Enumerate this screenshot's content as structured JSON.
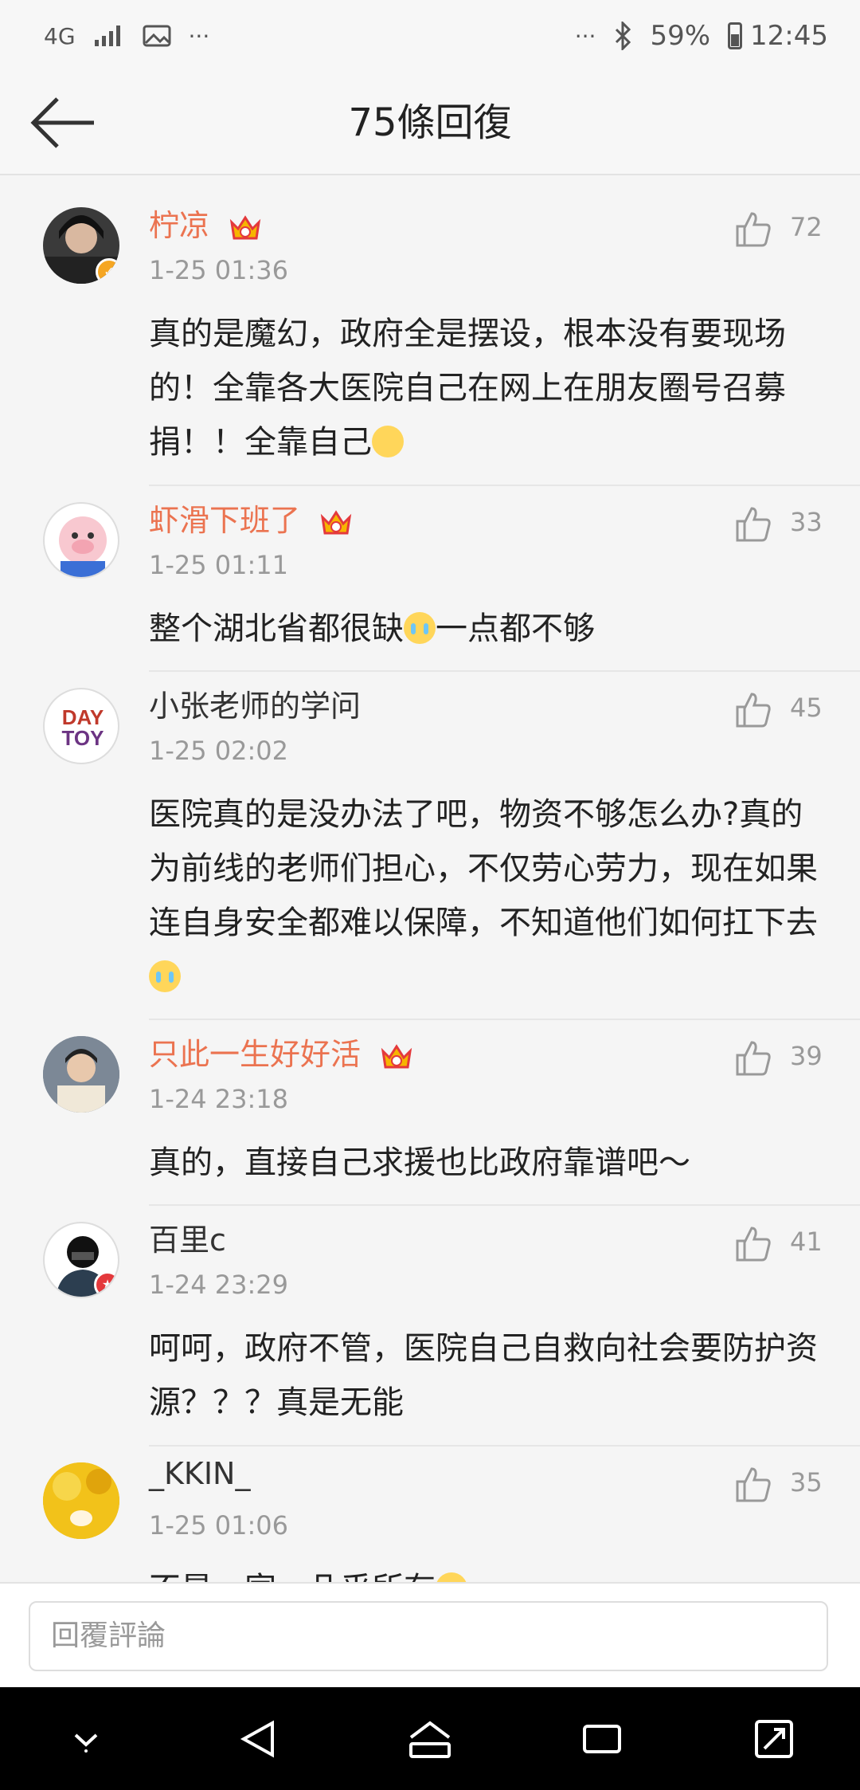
{
  "status": {
    "network": "4G",
    "battery": "59%",
    "time": "12:45",
    "more": "···"
  },
  "header": {
    "title": "75條回復"
  },
  "comments": [
    {
      "name": "柠凉",
      "time": "1-25 01:36",
      "likes": "72",
      "text": "真的是魔幻，政府全是摆设，根本没有要现场的！全靠各大医院自己在网上在朋友圈号召募捐！！全靠自己"
    },
    {
      "name": "虾滑下班了",
      "time": "1-25 01:11",
      "likes": "33",
      "text": "整个湖北省都很缺",
      "text2": "一点都不够"
    },
    {
      "name": "小张老师的学问",
      "time": "1-25 02:02",
      "likes": "45",
      "text": "医院真的是没办法了吧，物资不够怎么办?真的为前线的老师们担心，不仅劳心劳力，现在如果连自身安全都难以保障，不知道他们如何扛下去"
    },
    {
      "name": "只此一生好好活",
      "time": "1-24 23:18",
      "likes": "39",
      "text": "真的，直接自己求援也比政府靠谱吧～"
    },
    {
      "name": "百里c",
      "time": "1-24 23:29",
      "likes": "41",
      "text": "呵呵，政府不管，医院自己自救向社会要防护资源？？？真是无能"
    },
    {
      "name": "_KKIN_",
      "time": "1-25 01:06",
      "likes": "35",
      "text": "不是一家，几乎所有"
    }
  ],
  "reply": {
    "placeholder": "回覆評論"
  },
  "colors": {
    "vip_name": "#eb7350",
    "accent": "#f5a623"
  }
}
